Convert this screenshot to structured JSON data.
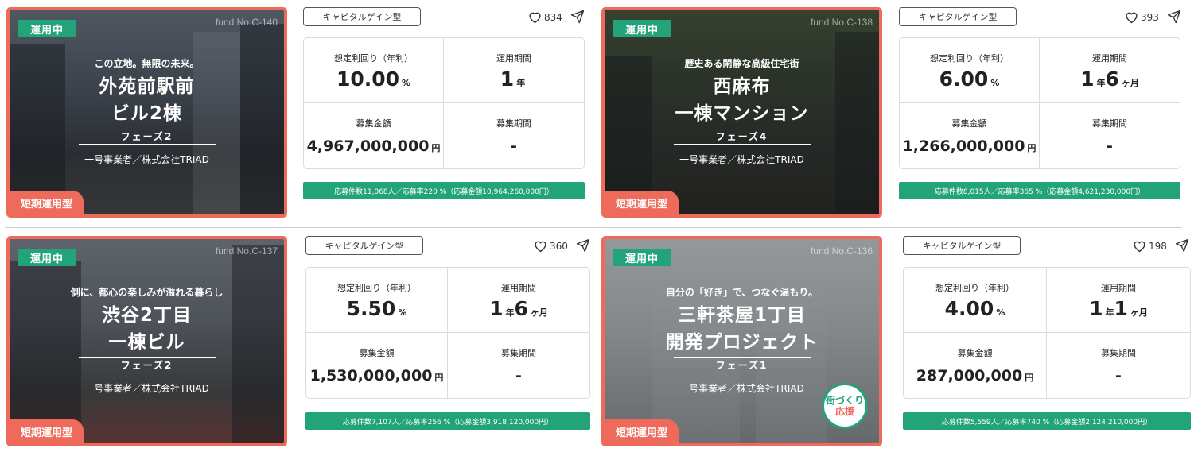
{
  "cards": [
    {
      "status": "運用中",
      "fund_no": "fund No.C-140",
      "tagline": "この立地。無限の未来。",
      "title1": "外苑前駅前",
      "title2": "ビル2棟",
      "phase": "フェーズ2",
      "operator": "一号事業者／株式会社TRIAD",
      "term_badge": "短期運用型",
      "type": "キャピタルゲイン型",
      "likes": "834",
      "yield_label": "想定利回り（年利）",
      "yield_value": "10.00",
      "yield_unit": "%",
      "period_label": "運用期間",
      "period_num1": "1",
      "period_unit1": "年",
      "period_num2": "",
      "period_unit2": "",
      "amount_label": "募集金額",
      "amount_value": "4,967,000,000",
      "amount_unit": "円",
      "recruit_label": "募集期間",
      "recruit_value": "-",
      "stats": "応募件数11,068人／応募率220 %（応募金額10,964,260,000円）"
    },
    {
      "status": "運用中",
      "fund_no": "fund No.C-138",
      "tagline": "歴史ある閑静な高級住宅街",
      "title1": "西麻布",
      "title2": "一棟マンション",
      "phase": "フェーズ4",
      "operator": "一号事業者／株式会社TRIAD",
      "term_badge": "短期運用型",
      "type": "キャピタルゲイン型",
      "likes": "393",
      "yield_label": "想定利回り（年利）",
      "yield_value": "6.00",
      "yield_unit": "%",
      "period_label": "運用期間",
      "period_num1": "1",
      "period_unit1": "年",
      "period_num2": "6",
      "period_unit2": "ヶ月",
      "amount_label": "募集金額",
      "amount_value": "1,266,000,000",
      "amount_unit": "円",
      "recruit_label": "募集期間",
      "recruit_value": "-",
      "stats": "応募件数8,015人／応募率365 %（応募金額4,621,230,000円）"
    },
    {
      "status": "運用中",
      "fund_no": "fund No.C-137",
      "tagline": "側に、都心の楽しみが溢れる暮らし",
      "title1": "渋谷2丁目",
      "title2": "一棟ビル",
      "phase": "フェーズ2",
      "operator": "一号事業者／株式会社TRIAD",
      "term_badge": "短期運用型",
      "type": "キャピタルゲイン型",
      "likes": "360",
      "yield_label": "想定利回り（年利）",
      "yield_value": "5.50",
      "yield_unit": "%",
      "period_label": "運用期間",
      "period_num1": "1",
      "period_unit1": "年",
      "period_num2": "6",
      "period_unit2": "ヶ月",
      "amount_label": "募集金額",
      "amount_value": "1,530,000,000",
      "amount_unit": "円",
      "recruit_label": "募集期間",
      "recruit_value": "-",
      "stats": "応募件数7,107人／応募率256 %（応募金額3,918,120,000円）"
    },
    {
      "status": "運用中",
      "fund_no": "fund No.C-136",
      "tagline": "自分の「好き」で、つなぐ温もり。",
      "title1": "三軒茶屋1丁目",
      "title2": "開発プロジェクト",
      "phase": "フェーズ1",
      "operator": "一号事業者／株式会社TRIAD",
      "term_badge": "短期運用型",
      "type": "キャピタルゲイン型",
      "likes": "198",
      "yield_label": "想定利回り（年利）",
      "yield_value": "4.00",
      "yield_unit": "%",
      "period_label": "運用期間",
      "period_num1": "1",
      "period_unit1": "年",
      "period_num2": "1",
      "period_unit2": "ヶ月",
      "amount_label": "募集金額",
      "amount_value": "287,000,000",
      "amount_unit": "円",
      "recruit_label": "募集期間",
      "recruit_value": "-",
      "stats": "応募件数5,559人／応募率740 %（応募金額2,124,210,000円）",
      "machi_logo": [
        "街づくり",
        "応援"
      ]
    }
  ],
  "colors": {
    "accent_red": "#ee6a5a",
    "accent_green": "#23a37a"
  },
  "icons": [
    "heart-icon",
    "share-icon"
  ]
}
